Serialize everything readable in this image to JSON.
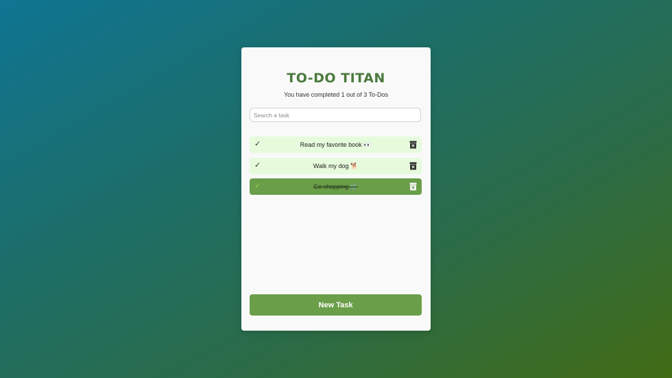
{
  "app": {
    "title": "TO-DO TITAN",
    "summary": "You have completed 1 out of 3 To-Dos"
  },
  "search": {
    "placeholder": "Search a task",
    "value": ""
  },
  "tasks": [
    {
      "text": "Read my favorite book 👀",
      "completed": false,
      "check_icon": "✓",
      "delete_icon": "archive-x-icon"
    },
    {
      "text": "Walk my dog 🐕",
      "completed": false,
      "check_icon": "✓",
      "delete_icon": "archive-x-icon"
    },
    {
      "text": "Go shopping 🛒",
      "completed": true,
      "check_icon": "✓",
      "delete_icon": "archive-x-icon"
    }
  ],
  "new_task_button": {
    "label": "New Task"
  },
  "colors": {
    "accent": "#6a9e49",
    "title": "#4a7a3c",
    "task_background": "#e6fbdc",
    "completed_check": "#8de04a",
    "card_background": "#f9f9f9"
  }
}
